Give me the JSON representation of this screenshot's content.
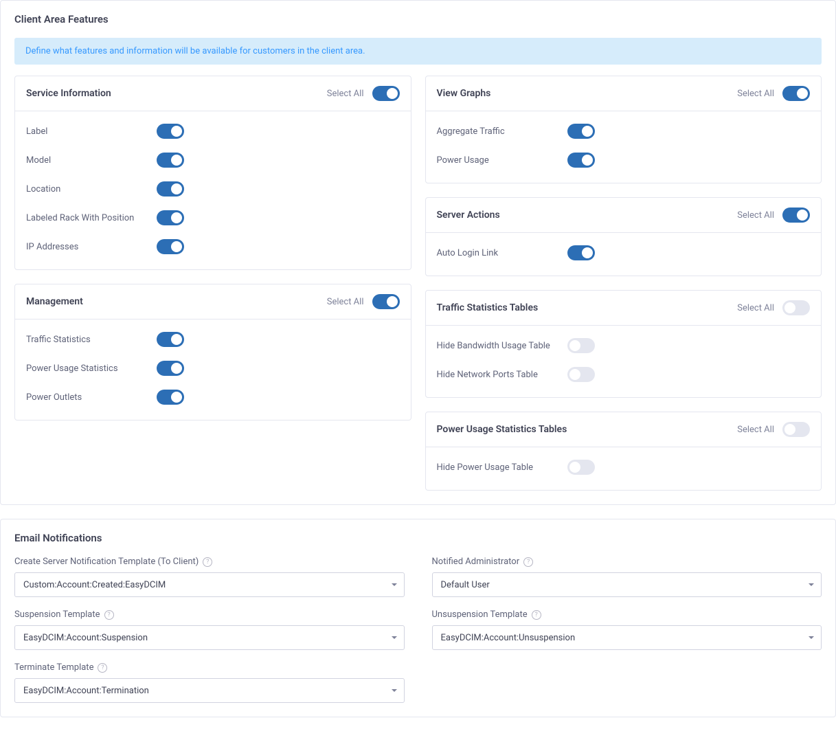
{
  "clientArea": {
    "title": "Client Area Features",
    "banner": "Define what features and information will be available for customers in the client area.",
    "selectAllLabel": "Select All",
    "panels": {
      "serviceInfo": {
        "title": "Service Information",
        "selectAllOn": true,
        "items": [
          {
            "label": "Label",
            "on": true
          },
          {
            "label": "Model",
            "on": true
          },
          {
            "label": "Location",
            "on": true
          },
          {
            "label": "Labeled Rack With Position",
            "on": true
          },
          {
            "label": "IP Addresses",
            "on": true
          }
        ]
      },
      "management": {
        "title": "Management",
        "selectAllOn": true,
        "items": [
          {
            "label": "Traffic Statistics",
            "on": true
          },
          {
            "label": "Power Usage Statistics",
            "on": true
          },
          {
            "label": "Power Outlets",
            "on": true
          }
        ]
      },
      "viewGraphs": {
        "title": "View Graphs",
        "selectAllOn": true,
        "items": [
          {
            "label": "Aggregate Traffic",
            "on": true
          },
          {
            "label": "Power Usage",
            "on": true
          }
        ]
      },
      "serverActions": {
        "title": "Server Actions",
        "selectAllOn": true,
        "items": [
          {
            "label": "Auto Login Link",
            "on": true
          }
        ]
      },
      "trafficStats": {
        "title": "Traffic Statistics Tables",
        "selectAllOn": false,
        "items": [
          {
            "label": "Hide Bandwidth Usage Table",
            "on": false
          },
          {
            "label": "Hide Network Ports Table",
            "on": false
          }
        ]
      },
      "powerStats": {
        "title": "Power Usage Statistics Tables",
        "selectAllOn": false,
        "items": [
          {
            "label": "Hide Power Usage Table",
            "on": false
          }
        ]
      }
    }
  },
  "emailNotifications": {
    "title": "Email Notifications",
    "fields": {
      "createServer": {
        "label": "Create Server Notification Template (To Client)",
        "value": "Custom:Account:Created:EasyDCIM"
      },
      "notifiedAdmin": {
        "label": "Notified Administrator",
        "value": "Default User"
      },
      "suspension": {
        "label": "Suspension Template",
        "value": "EasyDCIM:Account:Suspension"
      },
      "unsuspension": {
        "label": "Unsuspension Template",
        "value": "EasyDCIM:Account:Unsuspension"
      },
      "terminate": {
        "label": "Terminate Template",
        "value": "EasyDCIM:Account:Termination"
      }
    }
  }
}
